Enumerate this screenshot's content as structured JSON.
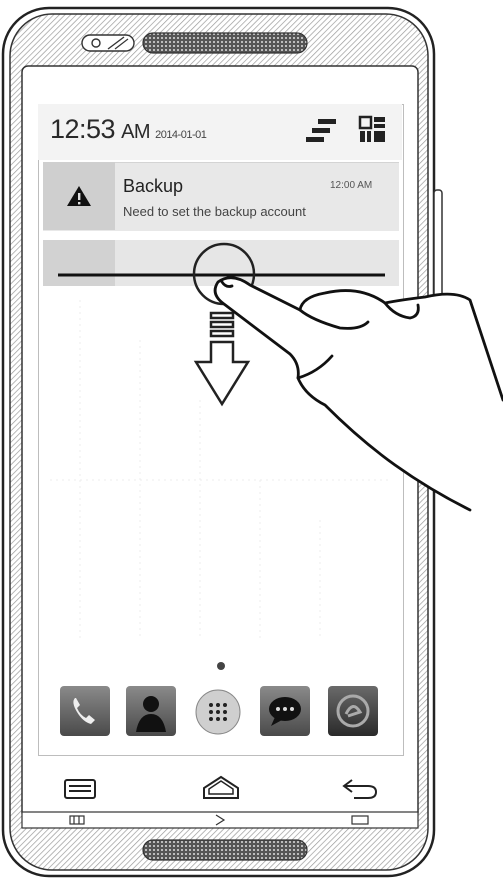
{
  "status_bar": {
    "time": "12:53",
    "ampm": "AM",
    "date": "2014-01-01"
  },
  "notifications": [
    {
      "icon": "warning-icon",
      "title": "Backup",
      "time": "12:00 AM",
      "body": "Need to set the backup account"
    }
  ],
  "quick_icons": [
    "settings-toggle-icon",
    "grid-icon"
  ],
  "dock": [
    "phone-icon",
    "contacts-icon",
    "apps-icon",
    "messages-icon",
    "browser-icon"
  ],
  "nav": [
    "recent-apps-icon",
    "home-icon",
    "back-icon"
  ],
  "gesture": "swipe-down"
}
